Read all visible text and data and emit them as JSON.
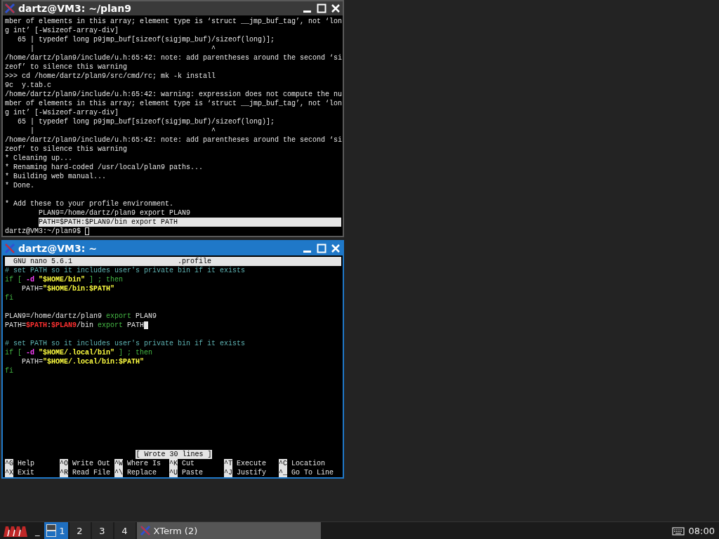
{
  "windows": [
    {
      "kind": "terminal",
      "title": "dartz@VM3: ~/plan9",
      "active": false,
      "blocks": [
        [
          {
            "text": "mber of elements in this array; element type is ‘struct __jmp_buf_tag’, not ‘lon",
            "selected": false
          },
          {
            "text": "g int’ [-Wsizeof-array-div]",
            "selected": false
          },
          {
            "text": "   65 | typedef long p9jmp_buf[sizeof(sigjmp_buf)/sizeof(long)];",
            "selected": false
          },
          {
            "text": "      |                                          ^",
            "selected": false
          },
          {
            "text": "/home/dartz/plan9/include/u.h:65:42: note: add parentheses around the second ‘si",
            "selected": false
          },
          {
            "text": "zeof’ to silence this warning",
            "selected": false
          },
          {
            "text": ">>> cd /home/dartz/plan9/src/cmd/rc; mk -k install",
            "selected": false
          },
          {
            "text": "9c  y.tab.c",
            "selected": false
          },
          {
            "text": "/home/dartz/plan9/include/u.h:65:42: warning: expression does not compute the nu",
            "selected": false
          },
          {
            "text": "mber of elements in this array; element type is ‘struct __jmp_buf_tag’, not ‘lon",
            "selected": false
          },
          {
            "text": "g int’ [-Wsizeof-array-div]",
            "selected": false
          },
          {
            "text": "   65 | typedef long p9jmp_buf[sizeof(sigjmp_buf)/sizeof(long)];",
            "selected": false
          },
          {
            "text": "      |                                          ^",
            "selected": false
          },
          {
            "text": "/home/dartz/plan9/include/u.h:65:42: note: add parentheses around the second ‘si",
            "selected": false
          },
          {
            "text": "zeof’ to silence this warning",
            "selected": false
          },
          {
            "text": "* Cleaning up...",
            "selected": false
          },
          {
            "text": "* Renaming hard-coded /usr/local/plan9 paths...",
            "selected": false
          },
          {
            "text": "* Building web manual...",
            "selected": false
          },
          {
            "text": "* Done.",
            "selected": false
          }
        ],
        [
          {
            "text": "* Add these to your profile environment.",
            "selected": false
          },
          {
            "text": "        PLAN9=/home/dartz/plan9 export PLAN9",
            "selected": false
          },
          {
            "text": "        PATH=$PATH:$PLAN9/bin export PATH",
            "selected": true
          }
        ]
      ],
      "prompt": {
        "text": "dartz@VM3:~/plan9$ ",
        "cursor": true
      }
    },
    {
      "kind": "nano",
      "title": "dartz@VM3: ~",
      "active": true,
      "header": {
        "version": "GNU nano 5.6.1",
        "filename": ".profile"
      },
      "blocks": [
        [
          [
            {
              "kind": "comment",
              "text": "# set PATH so it includes user's private bin if it exists"
            }
          ],
          [
            {
              "kind": "keyword",
              "text": "if [ "
            },
            {
              "kind": "flag",
              "text": "-d "
            },
            {
              "kind": "string",
              "text": "\"$HOME/bin\""
            },
            {
              "kind": "keyword",
              "text": " ] ; then"
            }
          ],
          [
            {
              "kind": "plain",
              "text": "    PATH="
            },
            {
              "kind": "string",
              "text": "\"$HOME/bin:$PATH\""
            }
          ],
          [
            {
              "kind": "keyword",
              "text": "fi"
            }
          ]
        ],
        [
          [
            {
              "kind": "plain",
              "text": "PLAN9=/home/dartz/plan9 "
            },
            {
              "kind": "keyword",
              "text": "export"
            },
            {
              "kind": "plain",
              "text": " PLAN9"
            }
          ],
          [
            {
              "kind": "plain",
              "text": "PATH="
            },
            {
              "kind": "variable",
              "text": "$PATH"
            },
            {
              "kind": "plain",
              "text": ":"
            },
            {
              "kind": "variable",
              "text": "$PLAN9"
            },
            {
              "kind": "plain",
              "text": "/bin "
            },
            {
              "kind": "keyword",
              "text": "export"
            },
            {
              "kind": "plain",
              "text": " PATH"
            },
            {
              "kind": "cursor"
            }
          ]
        ],
        [
          [
            {
              "kind": "comment",
              "text": "# set PATH so it includes user's private bin if it exists"
            }
          ],
          [
            {
              "kind": "keyword",
              "text": "if [ "
            },
            {
              "kind": "flag",
              "text": "-d "
            },
            {
              "kind": "string",
              "text": "\"$HOME/.local/bin\""
            },
            {
              "kind": "keyword",
              "text": " ] ; then"
            }
          ],
          [
            {
              "kind": "plain",
              "text": "    PATH="
            },
            {
              "kind": "string",
              "text": "\"$HOME/.local/bin:$PATH\""
            }
          ],
          [
            {
              "kind": "keyword",
              "text": "fi"
            }
          ]
        ]
      ],
      "status": "[ Wrote 30 lines ]",
      "shortcuts": [
        [
          {
            "key": "^G",
            "label": "Help"
          },
          {
            "key": "^O",
            "label": "Write Out"
          },
          {
            "key": "^W",
            "label": "Where Is"
          },
          {
            "key": "^K",
            "label": "Cut"
          },
          {
            "key": "^T",
            "label": "Execute"
          },
          {
            "key": "^C",
            "label": "Location"
          }
        ],
        [
          {
            "key": "^X",
            "label": "Exit"
          },
          {
            "key": "^R",
            "label": "Read File"
          },
          {
            "key": "^\\",
            "label": "Replace"
          },
          {
            "key": "^U",
            "label": "Paste"
          },
          {
            "key": "^J",
            "label": "Justify"
          },
          {
            "key": "^_",
            "label": "Go To Line"
          }
        ]
      ]
    }
  ],
  "taskbar": {
    "show_desktop": "_",
    "workspaces": [
      {
        "label": "1",
        "selected": true
      },
      {
        "label": "2",
        "selected": false
      },
      {
        "label": "3",
        "selected": false
      },
      {
        "label": "4",
        "selected": false
      }
    ],
    "tasks": [
      {
        "label": "XTerm (2)"
      }
    ],
    "clock": "08:00"
  }
}
